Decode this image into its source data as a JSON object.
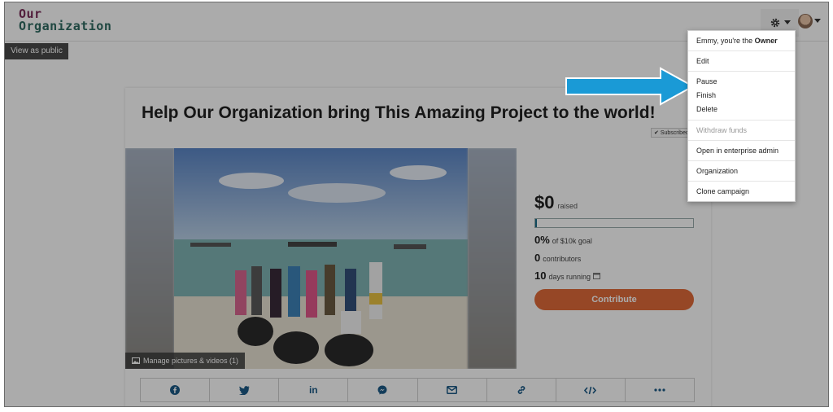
{
  "header": {
    "logo_line1": "Our",
    "logo_line2": "Organization",
    "view_public": "View as public"
  },
  "campaign": {
    "title": "Help Our Organization bring This Amazing Project to the world!",
    "subscribed": "Subscribed",
    "manage_media": "Manage pictures & videos (1)",
    "raised_amount": "$0",
    "raised_label": "raised",
    "progress_fraction": 0.01,
    "goal_pct": "0%",
    "goal_label": "of $10k goal",
    "contributors_count": "0",
    "contributors_label": "contributors",
    "days_count": "10",
    "days_label": "days running",
    "contribute_label": "Contribute"
  },
  "share_icons": [
    "facebook-icon",
    "twitter-icon",
    "linkedin-icon",
    "messenger-icon",
    "email-icon",
    "link-icon",
    "embed-icon",
    "more-icon"
  ],
  "menu": {
    "greeting_prefix": "Emmy, you're the ",
    "greeting_role": "Owner",
    "edit": "Edit",
    "pause": "Pause",
    "finish": "Finish",
    "delete": "Delete",
    "withdraw": "Withdraw funds",
    "enterprise": "Open in enterprise admin",
    "organization": "Organization",
    "clone": "Clone campaign"
  },
  "colors": {
    "accent": "#e06a3a",
    "arrow": "#1a9ad6",
    "logo_top": "#7b2d5a",
    "logo_bottom": "#2f6b62"
  }
}
